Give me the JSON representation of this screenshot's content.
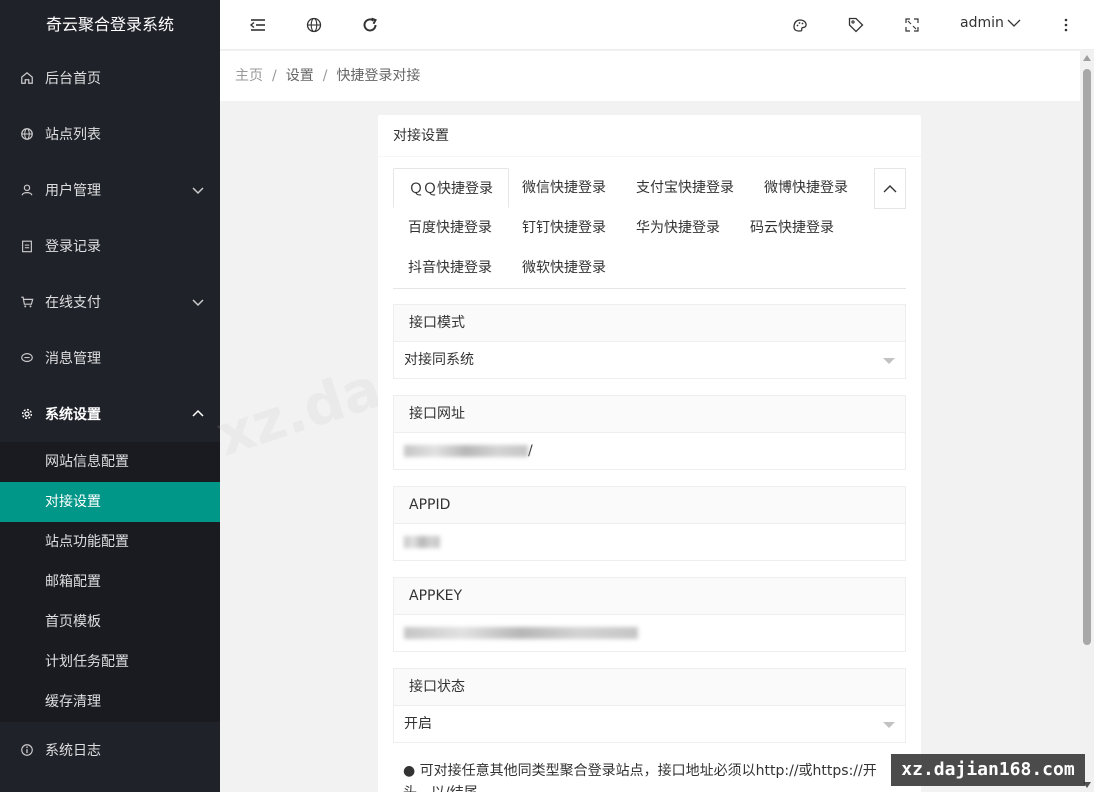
{
  "app": {
    "title": "奇云聚合登录系统"
  },
  "sidebar": {
    "items": [
      {
        "label": "后台首页",
        "icon": "home-icon"
      },
      {
        "label": "站点列表",
        "icon": "globe-icon"
      },
      {
        "label": "用户管理",
        "icon": "user-icon",
        "expandable": true
      },
      {
        "label": "登录记录",
        "icon": "clipboard-icon"
      },
      {
        "label": "在线支付",
        "icon": "cart-icon",
        "expandable": true
      },
      {
        "label": "消息管理",
        "icon": "chat-icon"
      },
      {
        "label": "系统设置",
        "icon": "gear-icon",
        "expandable": true,
        "expanded": true
      },
      {
        "label": "系统日志",
        "icon": "info-icon"
      }
    ],
    "submenu": [
      {
        "label": "网站信息配置"
      },
      {
        "label": "对接设置",
        "active": true
      },
      {
        "label": "站点功能配置"
      },
      {
        "label": "邮箱配置"
      },
      {
        "label": "首页模板"
      },
      {
        "label": "计划任务配置"
      },
      {
        "label": "缓存清理"
      }
    ]
  },
  "header": {
    "user": "admin",
    "icons": [
      "menu-collapse-icon",
      "globe-icon",
      "refresh-icon",
      "palette-icon",
      "tag-icon",
      "fullscreen-icon",
      "more-vertical-icon"
    ]
  },
  "breadcrumb": {
    "home": "主页",
    "parent": "设置",
    "current": "快捷登录对接",
    "separator": "/"
  },
  "card": {
    "title": "对接设置",
    "tabs": [
      {
        "label": "ＱＱ快捷登录",
        "active": true
      },
      {
        "label": "微信快捷登录"
      },
      {
        "label": "支付宝快捷登录"
      },
      {
        "label": "微博快捷登录"
      },
      {
        "label": "百度快捷登录"
      },
      {
        "label": "钉钉快捷登录"
      },
      {
        "label": "华为快捷登录"
      },
      {
        "label": "码云快捷登录"
      },
      {
        "label": "抖音快捷登录"
      },
      {
        "label": "微软快捷登录"
      }
    ],
    "fields": {
      "mode": {
        "label": "接口模式",
        "value": "对接同系统"
      },
      "url": {
        "label": "接口网址",
        "suffix": "/"
      },
      "appid": {
        "label": "APPID"
      },
      "appkey": {
        "label": "APPKEY"
      },
      "status": {
        "label": "接口状态",
        "value": "开启"
      }
    },
    "note": "● 可对接任意其他同类型聚合登录站点，接口地址必须以http://或https://开头，以/结尾"
  },
  "watermark": "xz.dajian168.com",
  "colors": {
    "sidebar_bg": "#20222a",
    "accent": "#009688",
    "page_bg": "#f2f2f2"
  }
}
